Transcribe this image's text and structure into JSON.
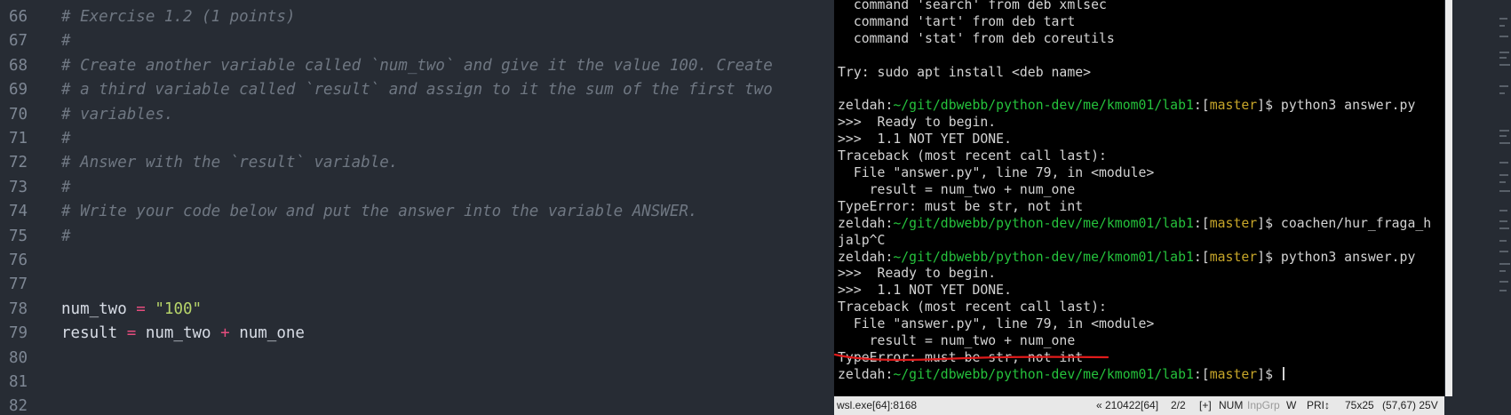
{
  "editor": {
    "lines": [
      {
        "num": "66",
        "parts": [
          {
            "t": "# Exercise 1.2 (1 points)",
            "c": "cmt"
          }
        ]
      },
      {
        "num": "67",
        "parts": [
          {
            "t": "#",
            "c": "cmt"
          }
        ]
      },
      {
        "num": "68",
        "parts": [
          {
            "t": "# Create another variable called `num_two` and give it the value 100. Create",
            "c": "cmt"
          }
        ]
      },
      {
        "num": "69",
        "parts": [
          {
            "t": "# a third variable called `result` and assign to it the sum of the first two",
            "c": "cmt"
          }
        ]
      },
      {
        "num": "70",
        "parts": [
          {
            "t": "# variables.",
            "c": "cmt"
          }
        ]
      },
      {
        "num": "71",
        "parts": [
          {
            "t": "#",
            "c": "cmt"
          }
        ]
      },
      {
        "num": "72",
        "parts": [
          {
            "t": "# Answer with the `result` variable.",
            "c": "cmt"
          }
        ]
      },
      {
        "num": "73",
        "parts": [
          {
            "t": "#",
            "c": "cmt"
          }
        ]
      },
      {
        "num": "74",
        "parts": [
          {
            "t": "# Write your code below and put the answer into the variable ANSWER.",
            "c": "cmt"
          }
        ]
      },
      {
        "num": "75",
        "parts": [
          {
            "t": "#",
            "c": "cmt"
          }
        ]
      },
      {
        "num": "76",
        "parts": []
      },
      {
        "num": "77",
        "parts": []
      },
      {
        "num": "78",
        "parts": [
          {
            "t": "num_two",
            "c": "var"
          },
          {
            "t": " = ",
            "c": "op"
          },
          {
            "t": "\"100\"",
            "c": "str"
          }
        ]
      },
      {
        "num": "79",
        "parts": [
          {
            "t": "result",
            "c": "var"
          },
          {
            "t": " = ",
            "c": "op"
          },
          {
            "t": "num_two",
            "c": "var"
          },
          {
            "t": " + ",
            "c": "op"
          },
          {
            "t": "num_one",
            "c": "var"
          }
        ]
      },
      {
        "num": "80",
        "parts": []
      },
      {
        "num": "81",
        "parts": []
      },
      {
        "num": "82",
        "parts": []
      }
    ]
  },
  "terminal": {
    "prompt": {
      "user": "zeldah:",
      "path": "~/git/dbwebb/python-dev/me/kmom01/lab1",
      "branch_open": ":[",
      "branch": "master",
      "branch_close": "]$ "
    },
    "lines": [
      {
        "type": "text",
        "text": "  command 'search' from deb xmlsec"
      },
      {
        "type": "text",
        "text": "  command 'tart' from deb tart"
      },
      {
        "type": "text",
        "text": "  command 'stat' from deb coreutils"
      },
      {
        "type": "text",
        "text": ""
      },
      {
        "type": "text",
        "text": "Try: sudo apt install <deb name>"
      },
      {
        "type": "text",
        "text": ""
      },
      {
        "type": "prompt",
        "cmd": "python3 answer.py"
      },
      {
        "type": "text",
        "text": ">>>  Ready to begin."
      },
      {
        "type": "text",
        "text": ">>>  1.1 NOT YET DONE."
      },
      {
        "type": "text",
        "text": "Traceback (most recent call last):"
      },
      {
        "type": "text",
        "text": "  File \"answer.py\", line 79, in <module>"
      },
      {
        "type": "text",
        "text": "    result = num_two + num_one"
      },
      {
        "type": "text",
        "text": "TypeError: must be str, not int"
      },
      {
        "type": "prompt",
        "cmd": "coachen/hur_fraga_h"
      },
      {
        "type": "text",
        "text": "jalp^C"
      },
      {
        "type": "prompt",
        "cmd": "python3 answer.py"
      },
      {
        "type": "text",
        "text": ">>>  Ready to begin."
      },
      {
        "type": "text",
        "text": ">>>  1.1 NOT YET DONE."
      },
      {
        "type": "text",
        "text": "Traceback (most recent call last):"
      },
      {
        "type": "text",
        "text": "  File \"answer.py\", line 79, in <module>"
      },
      {
        "type": "text",
        "text": "    result = num_two + num_one"
      },
      {
        "type": "text",
        "text": "TypeError: must be str, not int",
        "underlined": true
      },
      {
        "type": "prompt",
        "cmd": "",
        "cursor": true
      }
    ]
  },
  "statusbar": {
    "process": "wsl.exe[64]:8168",
    "buffer": "« 210422[64]",
    "tabs": "2/2",
    "lock": "[+]",
    "num": "NUM",
    "inpgrp": "InpGrp",
    "w": "W",
    "pri": "PRI↕",
    "size": "75x25",
    "cursor_pos": "(57,67) 25V"
  },
  "colors": {
    "editor_bg": "#272c34",
    "comment": "#6f7782",
    "keyword_op": "#e64d7e",
    "string": "#b7d56a",
    "terminal_bg": "#000000",
    "prompt_path": "#25c23c",
    "prompt_branch": "#c7a629",
    "annotation": "#e01b1b"
  }
}
